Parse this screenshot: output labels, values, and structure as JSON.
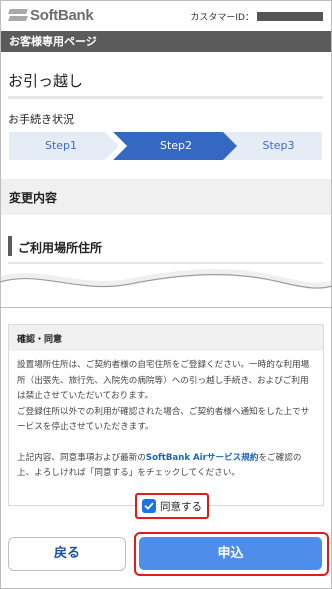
{
  "header": {
    "brand": "SoftBank",
    "customer_id_label": "カスタマーID：",
    "page_bar_title": "お客様専用ページ"
  },
  "page": {
    "title": "お引っ越し",
    "status_label": "お手続き状況"
  },
  "steps": {
    "items": [
      {
        "label": "Step1",
        "state": "done"
      },
      {
        "label": "Step2",
        "state": "active"
      },
      {
        "label": "Step3",
        "state": "pending"
      }
    ],
    "active_index": 1
  },
  "sections": {
    "change_content": "変更内容",
    "usage_address": "ご利用場所住所"
  },
  "confirm": {
    "heading": "確認・同意",
    "para1": "設置場所住所は、ご契約者様の自宅住所をご登録ください。一時的な利用場所（出張先、旅行先、入院先の病院等）への引っ越し手続き、およびご利用は禁止させていただいております。",
    "para2": "ご登録住所以外での利用が確認された場合、ご契約者様へ通知をした上でサービスを停止させていただきます。",
    "para3_prefix": "上記内容、同意事項および最新の",
    "para3_link": "SoftBank Airサービス規約",
    "para3_suffix": "をご確認の上、よろしければ「同意する」をチェックしてください。"
  },
  "agree": {
    "label": "同意する",
    "checked": true
  },
  "buttons": {
    "back": "戻る",
    "apply": "申込"
  },
  "colors": {
    "step_active": "#3568c3",
    "step_inactive": "#e6ecf5",
    "step_text_inactive": "#3a6fc4",
    "apply": "#4f8dea",
    "highlight": "#e01b1b",
    "link": "#1a66b3"
  }
}
